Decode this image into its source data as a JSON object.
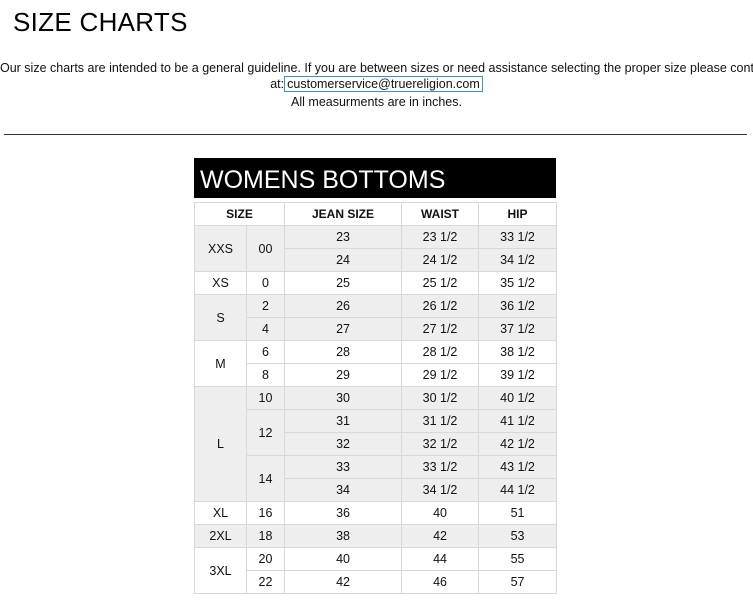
{
  "page": {
    "title": "SIZE CHARTS",
    "intro_line1": "Our size charts are intended to be a general guideline. If you are between sizes or need assistance selecting the proper size please contact us",
    "intro_prefix": "at:",
    "email": "customerservice@truereligion.com",
    "units_note": "All measurments are in inches."
  },
  "chart": {
    "title": "WOMENS BOTTOMS",
    "headers": [
      "SIZE",
      "JEAN SIZE",
      "WAIST",
      "HIP"
    ]
  },
  "chart_data": {
    "type": "table",
    "title": "WOMENS BOTTOMS",
    "columns": [
      "SIZE",
      "",
      "JEAN SIZE",
      "WAIST",
      "HIP"
    ],
    "groups": [
      {
        "size": "XXS",
        "numeric": [
          {
            "num": "00",
            "rows": [
              [
                "23",
                "23 1/2",
                "33 1/2"
              ],
              [
                "24",
                "24 1/2",
                "34 1/2"
              ]
            ]
          }
        ]
      },
      {
        "size": "XS",
        "numeric": [
          {
            "num": "0",
            "rows": [
              [
                "25",
                "25 1/2",
                "35 1/2"
              ]
            ]
          }
        ]
      },
      {
        "size": "S",
        "numeric": [
          {
            "num": "2",
            "rows": [
              [
                "26",
                "26 1/2",
                "36 1/2"
              ]
            ]
          },
          {
            "num": "4",
            "rows": [
              [
                "27",
                "27 1/2",
                "37 1/2"
              ]
            ]
          }
        ]
      },
      {
        "size": "M",
        "numeric": [
          {
            "num": "6",
            "rows": [
              [
                "28",
                "28 1/2",
                "38 1/2"
              ]
            ]
          },
          {
            "num": "8",
            "rows": [
              [
                "29",
                "29 1/2",
                "39 1/2"
              ]
            ]
          }
        ]
      },
      {
        "size": "L",
        "numeric": [
          {
            "num": "10",
            "rows": [
              [
                "30",
                "30 1/2",
                "40 1/2"
              ]
            ]
          },
          {
            "num": "12",
            "rows": [
              [
                "31",
                "31 1/2",
                "41 1/2"
              ],
              [
                "32",
                "32 1/2",
                "42 1/2"
              ]
            ]
          },
          {
            "num": "14",
            "rows": [
              [
                "33",
                "33 1/2",
                "43 1/2"
              ],
              [
                "34",
                "34 1/2",
                "44 1/2"
              ]
            ]
          }
        ]
      },
      {
        "size": "XL",
        "numeric": [
          {
            "num": "16",
            "rows": [
              [
                "36",
                "40",
                "51"
              ]
            ]
          }
        ]
      },
      {
        "size": "2XL",
        "numeric": [
          {
            "num": "18",
            "rows": [
              [
                "38",
                "42",
                "53"
              ]
            ]
          }
        ]
      },
      {
        "size": "3XL",
        "numeric": [
          {
            "num": "20",
            "rows": [
              [
                "40",
                "44",
                "55"
              ]
            ]
          },
          {
            "num": "22",
            "rows": [
              [
                "42",
                "46",
                "57"
              ]
            ]
          }
        ]
      }
    ]
  },
  "colors": {
    "title_bar_bg": "#000000",
    "title_bar_text": "#ffffff",
    "shaded_row": "#eeeeee",
    "link_border": "#3b8edb"
  }
}
